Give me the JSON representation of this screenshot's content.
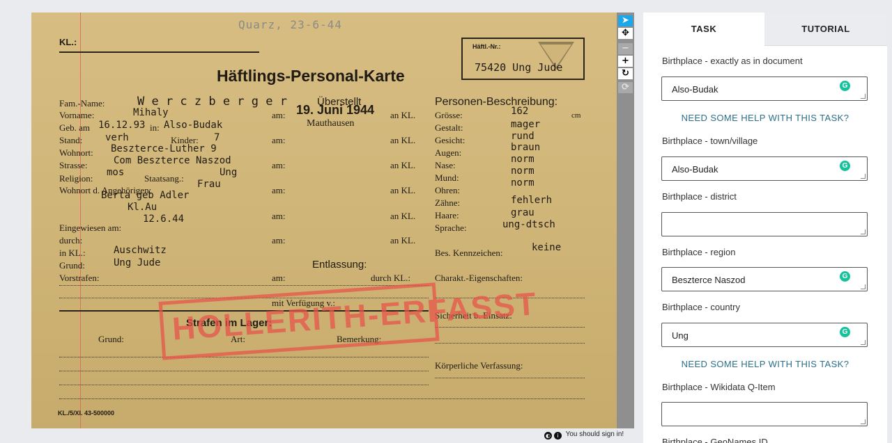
{
  "document": {
    "handwritten_note": "Quarz, 23-6-44",
    "kl_label": "KL.:",
    "haeftling_nr_label": "Häftl.-Nr.:",
    "haeftling_nr": "75420 Ung Jude",
    "title": "Häftlings-Personal-Karte",
    "ueberstellt": "Überstellt",
    "personen_beschreibung": "Personen-Beschreibung:",
    "labels": {
      "fam_name": "Fam.-Name:",
      "vorname": "Vorname:",
      "geb_am": "Geb. am",
      "in": "in:",
      "stand": "Stand:",
      "kinder": "Kinder:",
      "wohnort": "Wohnort:",
      "strasse": "Strasse:",
      "religion": "Religion:",
      "staatsang": "Staatsang.:",
      "wohnort_angehoerigen": "Wohnort d. Angehörigen:",
      "eingewiesen": "Eingewiesen am:",
      "durch": "durch:",
      "in_kl": "in KL.:",
      "grund": "Grund:",
      "vorstrafen": "Vorstrafen:",
      "am": "am:",
      "an_kl": "an KL.",
      "entlassung": "Entlassung:",
      "durch_kl": "durch KL.:",
      "mit_verfuegung": "mit Verfügung v.:",
      "groesse": "Grösse:",
      "gestalt": "Gestalt:",
      "gesicht": "Gesicht:",
      "augen": "Augen:",
      "nase": "Nase:",
      "mund": "Mund:",
      "ohren": "Ohren:",
      "zaehne": "Zähne:",
      "haare": "Haare:",
      "sprache": "Sprache:",
      "bes_kennzeichen": "Bes. Kennzeichen:",
      "charakt": "Charakt.-Eigenschaften:",
      "sicherheit": "Sicherheit b. Einsatz:",
      "koerperliche": "Körperliche Verfassung:",
      "strafen": "Strafen im Lager:",
      "grund2": "Grund:",
      "art": "Art:",
      "bemerkung": "Bemerkung:",
      "cm": "cm"
    },
    "values": {
      "fam_name": "W e r c z b e r g e r",
      "vorname": "Mihaly",
      "geb_date": "16.12.93",
      "geb_place": "Also-Budak",
      "stand": "verh",
      "kinder": "7",
      "wohnort": "Beszterce-Luther 9",
      "strasse": "Com Beszterce Naszod",
      "religion": "mos",
      "staatsang": "Ung",
      "angehoerige_1": "Frau",
      "angehoerige_2": "Berta geb Adler",
      "angehoerige_3": "Kl.Au",
      "angehoerige_4": "12.6.44",
      "in_kl": "Auschwitz",
      "grund": "Ung Jude",
      "transfer_date": "19. Juni 1944",
      "transfer_place": "Mauthausen",
      "groesse": "162",
      "gestalt": "mager",
      "gesicht": "rund",
      "augen": "braun",
      "nase": "norm",
      "mund": "norm",
      "ohren": "norm",
      "zaehne": "fehlerh",
      "haare": "grau",
      "sprache": "ung-dtsch",
      "kennzeichen": "keine"
    },
    "stamp": "HOLLERITH-ERFASST",
    "footer": "KL./5/XI. 43-500000"
  },
  "toolbar": {
    "tools": [
      {
        "icon": "pointer-icon",
        "glyph": "➤"
      },
      {
        "icon": "move-icon",
        "glyph": "✥"
      },
      {
        "icon": "zoom-out-icon",
        "glyph": "−"
      },
      {
        "icon": "zoom-in-icon",
        "glyph": "+"
      },
      {
        "icon": "rotate-icon",
        "glyph": "↻"
      },
      {
        "icon": "reset-icon",
        "glyph": "⟳"
      }
    ]
  },
  "signin": {
    "text": "You should sign in!"
  },
  "panel": {
    "tabs": {
      "task": "TASK",
      "tutorial": "TUTORIAL"
    },
    "fields": [
      {
        "label": "Birthplace - exactly as in document",
        "value": "Also-Budak"
      },
      {
        "label": "Birthplace - town/village",
        "value": "Also-Budak"
      },
      {
        "label": "Birthplace - district",
        "value": ""
      },
      {
        "label": "Birthplace - region",
        "value": "Beszterce Naszod"
      },
      {
        "label": "Birthplace - country",
        "value": "Ung"
      },
      {
        "label": "Birthplace - Wikidata Q-Item",
        "value": ""
      },
      {
        "label": "Birthplace - GeoNames ID",
        "value": ""
      }
    ],
    "help_text": "NEED SOME HELP WITH THIS TASK?",
    "colors": {
      "help": "#2b6f8a",
      "grammarly": "#15c39a",
      "active_tool": "#1ea7e8"
    }
  }
}
